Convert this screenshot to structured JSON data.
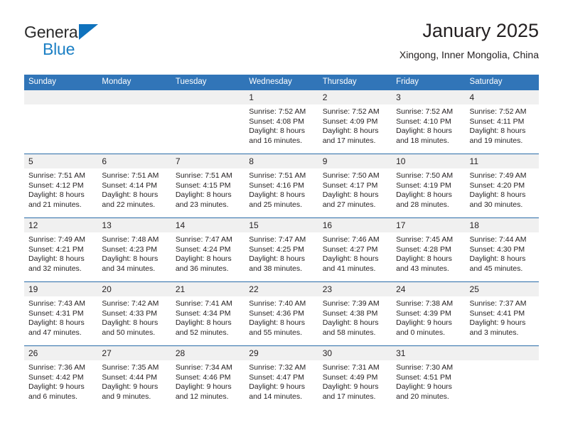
{
  "brand": {
    "name_top": "General",
    "name_bottom": "Blue",
    "flag_color": "#0f72bd",
    "blue_color": "#1b7fc4"
  },
  "header": {
    "title": "January 2025",
    "location": "Xingong, Inner Mongolia, China"
  },
  "theme": {
    "header_bg": "#3175b8",
    "divider": "#2a6ca8",
    "daynum_bg": "#f0f0f0",
    "text": "#231f20"
  },
  "weekdays": [
    "Sunday",
    "Monday",
    "Tuesday",
    "Wednesday",
    "Thursday",
    "Friday",
    "Saturday"
  ],
  "weeks": [
    [
      {
        "day": "",
        "lines": []
      },
      {
        "day": "",
        "lines": []
      },
      {
        "day": "",
        "lines": []
      },
      {
        "day": "1",
        "lines": [
          "Sunrise: 7:52 AM",
          "Sunset: 4:08 PM",
          "Daylight: 8 hours",
          "and 16 minutes."
        ]
      },
      {
        "day": "2",
        "lines": [
          "Sunrise: 7:52 AM",
          "Sunset: 4:09 PM",
          "Daylight: 8 hours",
          "and 17 minutes."
        ]
      },
      {
        "day": "3",
        "lines": [
          "Sunrise: 7:52 AM",
          "Sunset: 4:10 PM",
          "Daylight: 8 hours",
          "and 18 minutes."
        ]
      },
      {
        "day": "4",
        "lines": [
          "Sunrise: 7:52 AM",
          "Sunset: 4:11 PM",
          "Daylight: 8 hours",
          "and 19 minutes."
        ]
      }
    ],
    [
      {
        "day": "5",
        "lines": [
          "Sunrise: 7:51 AM",
          "Sunset: 4:12 PM",
          "Daylight: 8 hours",
          "and 21 minutes."
        ]
      },
      {
        "day": "6",
        "lines": [
          "Sunrise: 7:51 AM",
          "Sunset: 4:14 PM",
          "Daylight: 8 hours",
          "and 22 minutes."
        ]
      },
      {
        "day": "7",
        "lines": [
          "Sunrise: 7:51 AM",
          "Sunset: 4:15 PM",
          "Daylight: 8 hours",
          "and 23 minutes."
        ]
      },
      {
        "day": "8",
        "lines": [
          "Sunrise: 7:51 AM",
          "Sunset: 4:16 PM",
          "Daylight: 8 hours",
          "and 25 minutes."
        ]
      },
      {
        "day": "9",
        "lines": [
          "Sunrise: 7:50 AM",
          "Sunset: 4:17 PM",
          "Daylight: 8 hours",
          "and 27 minutes."
        ]
      },
      {
        "day": "10",
        "lines": [
          "Sunrise: 7:50 AM",
          "Sunset: 4:19 PM",
          "Daylight: 8 hours",
          "and 28 minutes."
        ]
      },
      {
        "day": "11",
        "lines": [
          "Sunrise: 7:49 AM",
          "Sunset: 4:20 PM",
          "Daylight: 8 hours",
          "and 30 minutes."
        ]
      }
    ],
    [
      {
        "day": "12",
        "lines": [
          "Sunrise: 7:49 AM",
          "Sunset: 4:21 PM",
          "Daylight: 8 hours",
          "and 32 minutes."
        ]
      },
      {
        "day": "13",
        "lines": [
          "Sunrise: 7:48 AM",
          "Sunset: 4:23 PM",
          "Daylight: 8 hours",
          "and 34 minutes."
        ]
      },
      {
        "day": "14",
        "lines": [
          "Sunrise: 7:47 AM",
          "Sunset: 4:24 PM",
          "Daylight: 8 hours",
          "and 36 minutes."
        ]
      },
      {
        "day": "15",
        "lines": [
          "Sunrise: 7:47 AM",
          "Sunset: 4:25 PM",
          "Daylight: 8 hours",
          "and 38 minutes."
        ]
      },
      {
        "day": "16",
        "lines": [
          "Sunrise: 7:46 AM",
          "Sunset: 4:27 PM",
          "Daylight: 8 hours",
          "and 41 minutes."
        ]
      },
      {
        "day": "17",
        "lines": [
          "Sunrise: 7:45 AM",
          "Sunset: 4:28 PM",
          "Daylight: 8 hours",
          "and 43 minutes."
        ]
      },
      {
        "day": "18",
        "lines": [
          "Sunrise: 7:44 AM",
          "Sunset: 4:30 PM",
          "Daylight: 8 hours",
          "and 45 minutes."
        ]
      }
    ],
    [
      {
        "day": "19",
        "lines": [
          "Sunrise: 7:43 AM",
          "Sunset: 4:31 PM",
          "Daylight: 8 hours",
          "and 47 minutes."
        ]
      },
      {
        "day": "20",
        "lines": [
          "Sunrise: 7:42 AM",
          "Sunset: 4:33 PM",
          "Daylight: 8 hours",
          "and 50 minutes."
        ]
      },
      {
        "day": "21",
        "lines": [
          "Sunrise: 7:41 AM",
          "Sunset: 4:34 PM",
          "Daylight: 8 hours",
          "and 52 minutes."
        ]
      },
      {
        "day": "22",
        "lines": [
          "Sunrise: 7:40 AM",
          "Sunset: 4:36 PM",
          "Daylight: 8 hours",
          "and 55 minutes."
        ]
      },
      {
        "day": "23",
        "lines": [
          "Sunrise: 7:39 AM",
          "Sunset: 4:38 PM",
          "Daylight: 8 hours",
          "and 58 minutes."
        ]
      },
      {
        "day": "24",
        "lines": [
          "Sunrise: 7:38 AM",
          "Sunset: 4:39 PM",
          "Daylight: 9 hours",
          "and 0 minutes."
        ]
      },
      {
        "day": "25",
        "lines": [
          "Sunrise: 7:37 AM",
          "Sunset: 4:41 PM",
          "Daylight: 9 hours",
          "and 3 minutes."
        ]
      }
    ],
    [
      {
        "day": "26",
        "lines": [
          "Sunrise: 7:36 AM",
          "Sunset: 4:42 PM",
          "Daylight: 9 hours",
          "and 6 minutes."
        ]
      },
      {
        "day": "27",
        "lines": [
          "Sunrise: 7:35 AM",
          "Sunset: 4:44 PM",
          "Daylight: 9 hours",
          "and 9 minutes."
        ]
      },
      {
        "day": "28",
        "lines": [
          "Sunrise: 7:34 AM",
          "Sunset: 4:46 PM",
          "Daylight: 9 hours",
          "and 12 minutes."
        ]
      },
      {
        "day": "29",
        "lines": [
          "Sunrise: 7:32 AM",
          "Sunset: 4:47 PM",
          "Daylight: 9 hours",
          "and 14 minutes."
        ]
      },
      {
        "day": "30",
        "lines": [
          "Sunrise: 7:31 AM",
          "Sunset: 4:49 PM",
          "Daylight: 9 hours",
          "and 17 minutes."
        ]
      },
      {
        "day": "31",
        "lines": [
          "Sunrise: 7:30 AM",
          "Sunset: 4:51 PM",
          "Daylight: 9 hours",
          "and 20 minutes."
        ]
      },
      {
        "day": "",
        "lines": []
      }
    ]
  ]
}
